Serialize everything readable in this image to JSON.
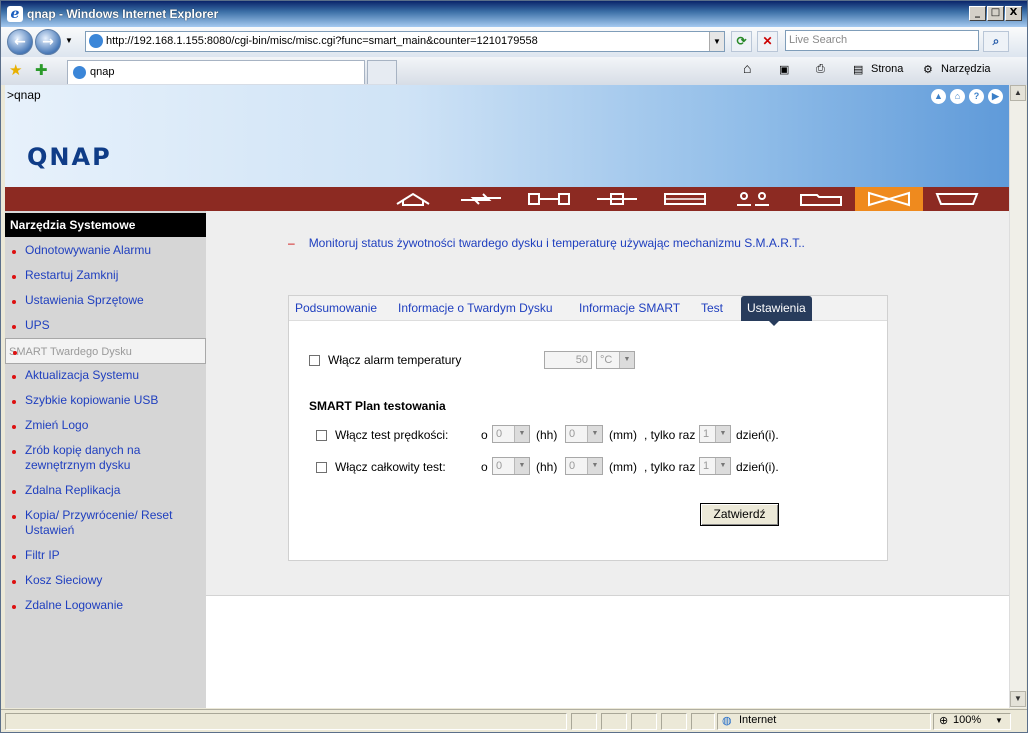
{
  "window": {
    "title": "qnap - Windows Internet Explorer",
    "min": "_",
    "max": "□",
    "close": "X"
  },
  "nav": {
    "address": "http://192.168.1.155:8080/cgi-bin/misc/misc.cgi?func=smart_main&counter=1210179558",
    "search_placeholder": "Live Search"
  },
  "tabs": {
    "current": "qnap"
  },
  "commands": {
    "page": "Strona",
    "tools": "Narzędzia"
  },
  "banner": {
    "brand": ">qnap",
    "logo": "QNAP"
  },
  "menubar": {
    "icons": [
      "home-icon",
      "quick-config-icon",
      "system-settings-icon",
      "network-icon",
      "device-config-icon",
      "users-icon",
      "shares-icon",
      "system-tools-icon",
      "logs-icon"
    ],
    "active_index": 7,
    "active_color": "#ef8a1e",
    "bar_color": "#8c2a22"
  },
  "sidebar": {
    "title": "Narzędzia Systemowe",
    "items": [
      {
        "label": "Odnotowywanie Alarmu"
      },
      {
        "label": "Restartuj Zamknij"
      },
      {
        "label": "Ustawienia Sprzętowe"
      },
      {
        "label": "UPS"
      },
      {
        "label": "SMART Twardego Dysku",
        "selected": true
      },
      {
        "label": "Aktualizacja Systemu"
      },
      {
        "label": "Szybkie kopiowanie USB"
      },
      {
        "label": "Zmień Logo"
      },
      {
        "label": "Zrób kopię danych na zewnętrznym dysku"
      },
      {
        "label": "Zdalna Replikacja"
      },
      {
        "label": "Kopia/ Przywrócenie/ Reset Ustawień"
      },
      {
        "label": "Filtr IP"
      },
      {
        "label": "Kosz Sieciowy"
      },
      {
        "label": "Zdalne Logowanie"
      }
    ]
  },
  "main": {
    "intro": "Monitoruj status żywotności twardego dysku i temperaturę używając mechanizmu S.M.A.R.T..",
    "tabs": [
      "Podsumowanie",
      "Informacje o Twardym Dysku",
      "Informacje SMART",
      "Test",
      "Ustawienia"
    ],
    "active_tab": "Ustawienia",
    "temp_alarm": {
      "label": "Włącz alarm temperatury",
      "value": "50",
      "unit": "°C"
    },
    "plan_title": "SMART Plan testowania",
    "fast_test": {
      "label": "Włącz test prędkości:",
      "o": "o",
      "hh_val": "0",
      "hh": "(hh)",
      "mm_val": "0",
      "mm": "(mm)",
      "only": ", tylko raz",
      "days_val": "1",
      "days": "dzień(i)."
    },
    "full_test": {
      "label": "Włącz całkowity test:",
      "o": "o",
      "hh_val": "0",
      "hh": "(hh)",
      "mm_val": "0",
      "mm": "(mm)",
      "only": ", tylko raz",
      "days_val": "1",
      "days": "dzień(i)."
    },
    "submit": "Zatwierdź"
  },
  "status": {
    "zone": "Internet",
    "zoom": "100%"
  }
}
